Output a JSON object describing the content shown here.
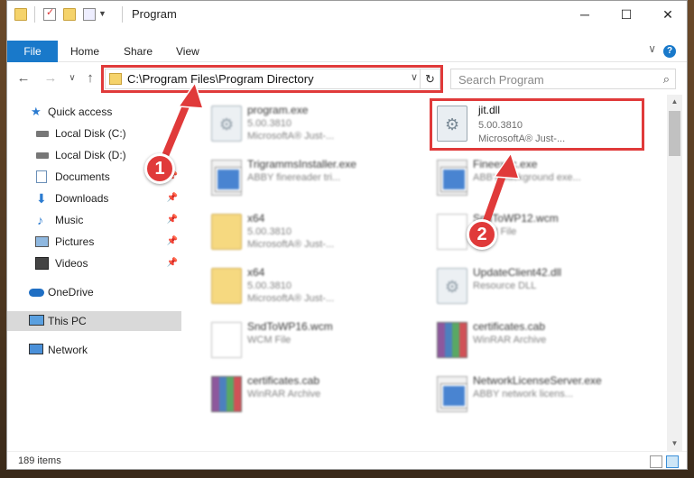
{
  "window": {
    "title": "Program",
    "minimize": "─",
    "maximize": "☐",
    "close": "✕"
  },
  "ribbon": {
    "tabs": [
      "File",
      "Home",
      "Share",
      "View"
    ],
    "help": "?",
    "collapse": "∨"
  },
  "nav": {
    "back": "←",
    "forward": "→",
    "recent": "∨",
    "up": "↑",
    "address": "C:\\Program Files\\Program Directory",
    "address_dropdown": "∨",
    "refresh": "↻",
    "search_placeholder": "Search Program",
    "search_icon": "⌕"
  },
  "sidebar": {
    "items": [
      {
        "label": "Quick access",
        "icon": "star-icon"
      },
      {
        "label": "Local Disk (C:)",
        "icon": "drive-icon"
      },
      {
        "label": "Local Disk (D:)",
        "icon": "drive-icon"
      },
      {
        "label": "Documents",
        "icon": "documents-icon"
      },
      {
        "label": "Downloads",
        "icon": "download-icon"
      },
      {
        "label": "Music",
        "icon": "music-icon"
      },
      {
        "label": "Pictures",
        "icon": "pictures-icon"
      },
      {
        "label": "Videos",
        "icon": "videos-icon"
      },
      {
        "label": "OneDrive",
        "icon": "cloud-icon"
      },
      {
        "label": "This PC",
        "icon": "computer-icon"
      },
      {
        "label": "Network",
        "icon": "network-icon"
      }
    ],
    "pin": "📌"
  },
  "files": {
    "items": [
      {
        "name": "program.exe",
        "line1": "5.00.3810",
        "line2": "MicrosoftA® Just-...",
        "icon": "gear-icon"
      },
      {
        "name": "jit.dll",
        "line1": "5.00.3810",
        "line2": "MicrosoftA® Just-...",
        "icon": "gear-icon"
      },
      {
        "name": "TrigrammsInstaller.exe",
        "line1": "ABBY finereader tri...",
        "line2": "",
        "icon": "exe-icon"
      },
      {
        "name": "Fineexec.exe",
        "line1": "ABBY background exe...",
        "line2": "",
        "icon": "exe-icon"
      },
      {
        "name": "x64",
        "line1": "5.00.3810",
        "line2": "MicrosoftA® Just-...",
        "icon": "folder-icon"
      },
      {
        "name": "SndToWP12.wcm",
        "line1": "WCM File",
        "line2": "",
        "icon": "document-icon"
      },
      {
        "name": "x64",
        "line1": "5.00.3810",
        "line2": "MicrosoftA® Just-...",
        "icon": "folder-icon"
      },
      {
        "name": "UpdateClient42.dll",
        "line1": "Resource DLL",
        "line2": "",
        "icon": "gear-icon"
      },
      {
        "name": "SndToWP16.wcm",
        "line1": "WCM File",
        "line2": "",
        "icon": "document-icon"
      },
      {
        "name": "certificates.cab",
        "line1": "WinRAR Archive",
        "line2": "",
        "icon": "archive-icon"
      },
      {
        "name": "certificates.cab",
        "line1": "WinRAR Archive",
        "line2": "",
        "icon": "archive-icon"
      },
      {
        "name": "NetworkLicenseServer.exe",
        "line1": "ABBY network licens...",
        "line2": "",
        "icon": "exe-icon"
      }
    ]
  },
  "annotations": {
    "step1": "1",
    "step2": "2",
    "accent": "#e03a3a"
  },
  "status": {
    "count": "189 items"
  },
  "colors": {
    "file_tab": "#1979ca",
    "highlight": "#e03a3a",
    "selected": "#d9d9d9"
  }
}
